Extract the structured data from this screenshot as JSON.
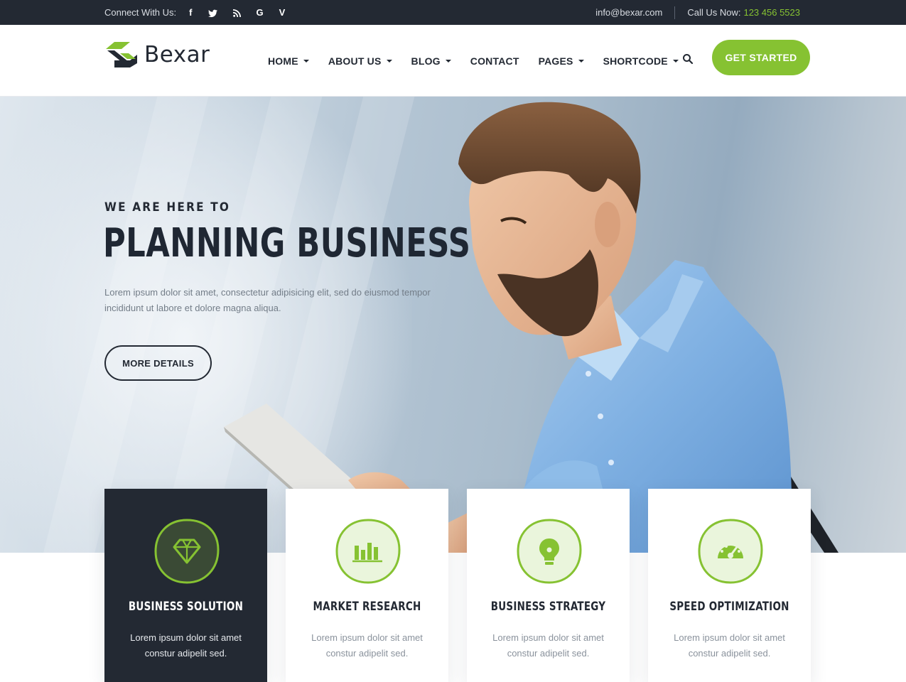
{
  "topbar": {
    "connect_label": "Connect With Us:",
    "social_icons": [
      "facebook-icon",
      "twitter-icon",
      "rss-icon",
      "google-icon",
      "vimeo-icon"
    ],
    "social_glyphs": [
      "f",
      "🐦",
      "≋",
      "G",
      "V"
    ],
    "email": "info@bexar.com",
    "call_label": "Call Us Now:",
    "phone": "123 456 5523"
  },
  "header": {
    "logo_text": "Bexar",
    "nav": [
      {
        "label": "HOME",
        "dropdown": true
      },
      {
        "label": "ABOUT US",
        "dropdown": true
      },
      {
        "label": "BLOG",
        "dropdown": true
      },
      {
        "label": "CONTACT",
        "dropdown": false
      },
      {
        "label": "PAGES",
        "dropdown": true
      },
      {
        "label": "SHORTCODE",
        "dropdown": true
      }
    ],
    "cta_label": "GET STARTED"
  },
  "hero": {
    "kicker": "WE ARE HERE TO",
    "headline": "PLANNING BUSINESS",
    "lead": "Lorem ipsum dolor sit amet, consectetur adipisicing elit, sed do eiusmod tempor incididunt ut labore et dolore magna aliqua.",
    "button_label": "MORE DETAILS"
  },
  "services": [
    {
      "title": "BUSINESS SOLUTION",
      "text": "Lorem ipsum dolor sit amet constur adipelit sed.",
      "icon": "diamond-icon",
      "active": true
    },
    {
      "title": "MARKET RESEARCH",
      "text": "Lorem ipsum dolor sit amet constur adipelit sed.",
      "icon": "bar-chart-icon",
      "active": false
    },
    {
      "title": "BUSINESS STRATEGY",
      "text": "Lorem ipsum dolor sit amet constur adipelit sed.",
      "icon": "lightbulb-icon",
      "active": false
    },
    {
      "title": "SPEED OPTIMIZATION",
      "text": "Lorem ipsum dolor sit amet constur adipelit sed.",
      "icon": "speedometer-icon",
      "active": false
    }
  ],
  "colors": {
    "accent": "#86c232",
    "dark": "#232933",
    "text_muted": "#737d88"
  }
}
